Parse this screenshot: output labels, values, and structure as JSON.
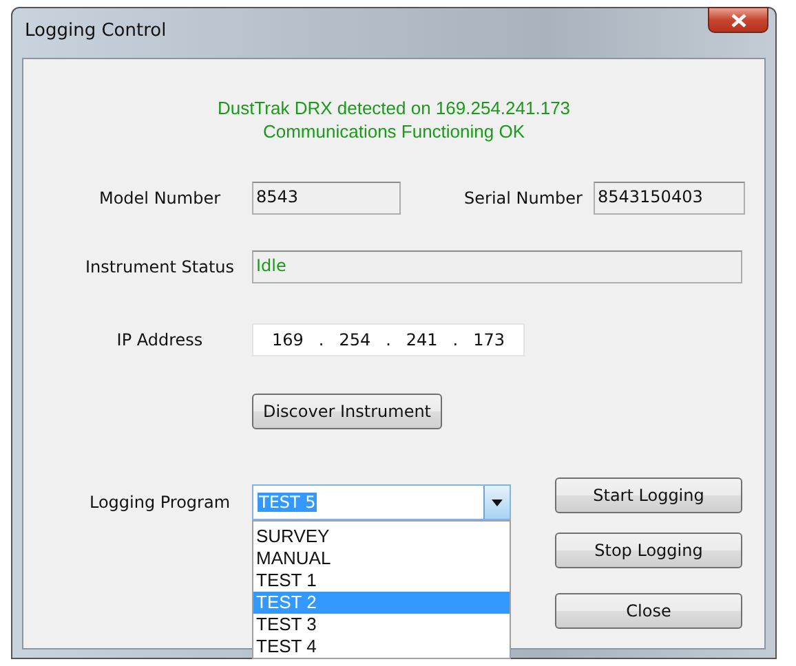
{
  "window": {
    "title": "Logging Control"
  },
  "status_message": {
    "lines": [
      "DustTrak DRX detected on 169.254.241.173",
      "Communications Functioning OK"
    ]
  },
  "model_number": {
    "label": "Model Number",
    "value": "8543"
  },
  "serial_number": {
    "label": "Serial Number",
    "value": "8543150403"
  },
  "instrument_status": {
    "label": "Instrument Status",
    "value": "Idle"
  },
  "ip_address": {
    "label": "IP Address",
    "octets": [
      "169",
      "254",
      "241",
      "173"
    ],
    "separator": "."
  },
  "discover_button": "Discover Instrument",
  "logging_program": {
    "label": "Logging Program",
    "value": "TEST 5",
    "expanded": true,
    "items": [
      {
        "label": "SURVEY",
        "selected": false
      },
      {
        "label": "MANUAL",
        "selected": false
      },
      {
        "label": "TEST 1",
        "selected": false
      },
      {
        "label": "TEST 2",
        "selected": true
      },
      {
        "label": "TEST 3",
        "selected": false
      },
      {
        "label": "TEST 4",
        "selected": false
      }
    ]
  },
  "buttons": [
    "Start Logging",
    "Stop Logging",
    "Close"
  ]
}
